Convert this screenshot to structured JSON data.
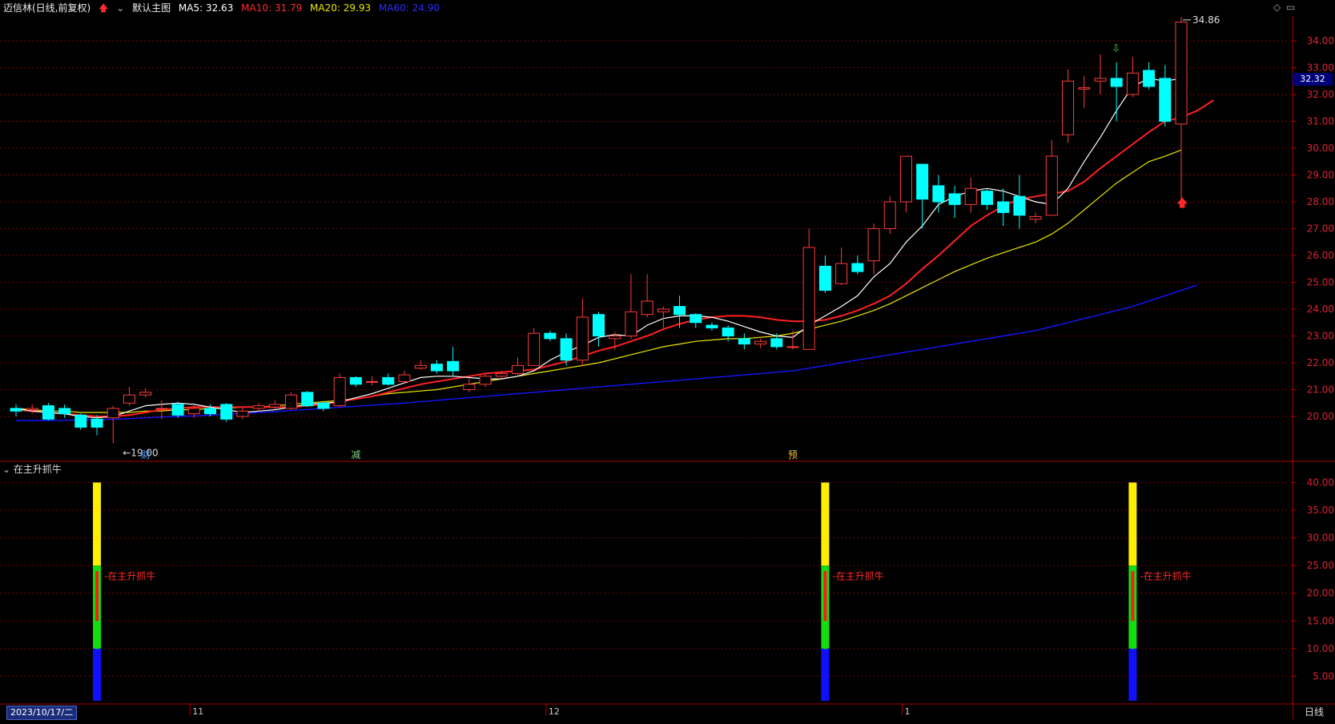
{
  "header": {
    "stock_name": "迈信林(日线,前复权)",
    "main_chart_label": "默认主图",
    "ma5": "MA5: 32.63",
    "ma10": "MA10: 31.79",
    "ma20": "MA20: 29.93",
    "ma60": "MA60: 24.90"
  },
  "colors": {
    "up": "#ff3b3b",
    "down": "#00ffff",
    "ma5": "#ffffff",
    "ma10": "#ff2020",
    "ma20": "#e8e800",
    "ma60": "#1515ff",
    "grid": "#7a0000"
  },
  "price_axis_labels": [
    "34.00",
    "33.00",
    "32.00",
    "31.00",
    "30.00",
    "29.00",
    "28.00",
    "27.00",
    "26.00",
    "25.00",
    "24.00",
    "23.00",
    "22.00",
    "21.00",
    "20.00"
  ],
  "current_price_tag": "32.32",
  "annotations": {
    "high_label": "34.86",
    "low_label": "19.00",
    "events": [
      "财",
      "减",
      "预"
    ]
  },
  "indicator": {
    "title": "在主升抓牛",
    "axis_labels": [
      "40.00",
      "35.00",
      "30.00",
      "25.00",
      "20.00",
      "15.00",
      "10.00",
      "5.00"
    ],
    "signal_label": "在主升抓牛"
  },
  "time_axis": {
    "cursor_date": "2023/10/17/二",
    "month_labels": [
      "11",
      "12",
      "1"
    ],
    "period": "日线"
  },
  "chart_data": {
    "type": "candlestick",
    "ylim": [
      19.0,
      35.0
    ],
    "candles": [
      [
        20.3,
        20.2,
        20.45,
        20.0
      ],
      [
        20.25,
        20.3,
        20.45,
        20.1
      ],
      [
        20.4,
        19.9,
        20.5,
        19.85
      ],
      [
        20.3,
        20.1,
        20.45,
        19.95
      ],
      [
        20.05,
        19.6,
        20.1,
        19.5
      ],
      [
        19.9,
        19.6,
        20.05,
        19.3
      ],
      [
        19.95,
        20.3,
        20.4,
        19.0
      ],
      [
        20.5,
        20.8,
        21.1,
        20.4
      ],
      [
        20.8,
        20.9,
        21.05,
        20.7
      ],
      [
        20.3,
        20.3,
        20.6,
        19.9
      ],
      [
        20.45,
        20.05,
        20.55,
        19.95
      ],
      [
        20.1,
        20.3,
        20.4,
        19.95
      ],
      [
        20.3,
        20.1,
        20.45,
        20.0
      ],
      [
        20.45,
        19.9,
        20.5,
        19.8
      ],
      [
        20.0,
        20.2,
        20.35,
        19.9
      ],
      [
        20.3,
        20.4,
        20.5,
        20.2
      ],
      [
        20.35,
        20.45,
        20.6,
        20.25
      ],
      [
        20.3,
        20.8,
        20.9,
        20.25
      ],
      [
        20.9,
        20.4,
        20.95,
        20.35
      ],
      [
        20.5,
        20.3,
        20.55,
        20.2
      ],
      [
        20.4,
        21.45,
        21.6,
        20.35
      ],
      [
        21.45,
        21.2,
        21.5,
        21.1
      ],
      [
        21.3,
        21.3,
        21.5,
        21.15
      ],
      [
        21.45,
        21.2,
        21.6,
        21.15
      ],
      [
        21.3,
        21.55,
        21.7,
        21.2
      ],
      [
        21.8,
        21.9,
        22.1,
        21.75
      ],
      [
        21.95,
        21.7,
        22.1,
        21.6
      ],
      [
        22.05,
        21.7,
        22.6,
        21.5
      ],
      [
        21.0,
        21.2,
        21.4,
        20.9
      ],
      [
        21.2,
        21.5,
        21.6,
        21.1
      ],
      [
        21.5,
        21.6,
        21.7,
        21.4
      ],
      [
        21.6,
        21.9,
        22.2,
        21.5
      ],
      [
        21.9,
        23.1,
        23.3,
        21.9
      ],
      [
        23.1,
        22.9,
        23.2,
        22.8
      ],
      [
        22.9,
        22.1,
        23.1,
        21.9
      ],
      [
        22.1,
        23.7,
        24.4,
        21.9
      ],
      [
        23.8,
        23.0,
        23.9,
        22.6
      ],
      [
        22.9,
        23.0,
        23.15,
        22.5
      ],
      [
        23.0,
        23.9,
        25.3,
        22.9
      ],
      [
        23.8,
        24.3,
        25.3,
        23.7
      ],
      [
        23.9,
        24.0,
        24.1,
        23.3
      ],
      [
        24.1,
        23.8,
        24.5,
        23.3
      ],
      [
        23.8,
        23.5,
        23.85,
        23.3
      ],
      [
        23.4,
        23.3,
        23.5,
        23.2
      ],
      [
        23.3,
        23.0,
        23.4,
        22.8
      ],
      [
        22.9,
        22.7,
        23.1,
        22.5
      ],
      [
        22.7,
        22.8,
        22.9,
        22.55
      ],
      [
        22.9,
        22.6,
        23.1,
        22.5
      ],
      [
        22.6,
        22.6,
        23.2,
        22.5
      ],
      [
        22.5,
        26.3,
        27.0,
        22.5
      ],
      [
        25.6,
        24.7,
        26.0,
        24.6
      ],
      [
        24.95,
        25.7,
        26.3,
        24.9
      ],
      [
        25.7,
        25.4,
        26.0,
        25.3
      ],
      [
        25.8,
        27.0,
        27.2,
        25.3
      ],
      [
        27.0,
        28.0,
        28.2,
        26.8
      ],
      [
        28.0,
        29.7,
        29.7,
        27.6
      ],
      [
        29.4,
        28.1,
        29.4,
        27.0
      ],
      [
        28.6,
        28.0,
        29.0,
        27.6
      ],
      [
        28.3,
        27.9,
        28.6,
        27.4
      ],
      [
        27.9,
        28.5,
        28.9,
        27.6
      ],
      [
        28.4,
        27.9,
        28.5,
        27.7
      ],
      [
        28.0,
        27.6,
        28.5,
        27.1
      ],
      [
        28.2,
        27.5,
        29.0,
        27.0
      ],
      [
        27.35,
        27.45,
        27.6,
        27.2
      ],
      [
        27.5,
        29.7,
        30.3,
        27.5
      ],
      [
        30.5,
        32.5,
        32.95,
        30.2
      ],
      [
        32.2,
        32.25,
        32.7,
        31.5
      ],
      [
        32.5,
        32.6,
        33.5,
        32.0
      ],
      [
        32.6,
        32.3,
        33.2,
        31.0
      ],
      [
        32.0,
        32.8,
        33.4,
        31.9
      ],
      [
        32.9,
        32.3,
        33.2,
        32.2
      ],
      [
        32.6,
        31.0,
        33.1,
        30.8
      ],
      [
        30.9,
        34.7,
        34.9,
        27.9
      ]
    ],
    "ma5": [
      20.3,
      20.2,
      20.15,
      20.1,
      20.0,
      19.95,
      20.0,
      20.2,
      20.4,
      20.45,
      20.5,
      20.45,
      20.35,
      20.25,
      20.15,
      20.2,
      20.25,
      20.35,
      20.45,
      20.5,
      20.55,
      20.7,
      20.85,
      21.05,
      21.25,
      21.45,
      21.5,
      21.5,
      21.45,
      21.4,
      21.4,
      21.5,
      21.7,
      22.1,
      22.4,
      22.65,
      22.95,
      23.05,
      23.0,
      23.4,
      23.65,
      23.75,
      23.75,
      23.7,
      23.55,
      23.35,
      23.15,
      23.0,
      22.95,
      23.4,
      23.75,
      24.1,
      24.5,
      25.2,
      25.7,
      26.5,
      27.1,
      27.9,
      28.2,
      28.4,
      28.5,
      28.4,
      28.2,
      28.0,
      27.9,
      28.5,
      29.5,
      30.4,
      31.4,
      32.3,
      32.6,
      32.5,
      32.6
    ],
    "ma10": [
      20.25,
      20.2,
      20.15,
      20.1,
      20.05,
      20.0,
      20.0,
      20.05,
      20.15,
      20.25,
      20.3,
      20.35,
      20.35,
      20.35,
      20.35,
      20.35,
      20.35,
      20.35,
      20.4,
      20.45,
      20.55,
      20.65,
      20.75,
      20.9,
      21.05,
      21.2,
      21.3,
      21.4,
      21.5,
      21.6,
      21.65,
      21.7,
      21.75,
      21.9,
      22.05,
      22.25,
      22.45,
      22.6,
      22.8,
      23.0,
      23.25,
      23.45,
      23.6,
      23.7,
      23.75,
      23.75,
      23.7,
      23.6,
      23.55,
      23.55,
      23.6,
      23.75,
      23.95,
      24.2,
      24.5,
      24.95,
      25.5,
      26.0,
      26.55,
      27.1,
      27.5,
      27.85,
      28.1,
      28.2,
      28.3,
      28.4,
      28.75,
      29.25,
      29.7,
      30.15,
      30.6,
      31.0,
      31.15,
      31.4,
      31.79
    ],
    "ma20": [
      20.3,
      20.25,
      20.2,
      20.2,
      20.15,
      20.15,
      20.15,
      20.15,
      20.2,
      20.2,
      20.25,
      20.25,
      20.3,
      20.3,
      20.35,
      20.35,
      20.4,
      20.45,
      20.5,
      20.55,
      20.6,
      20.65,
      20.75,
      20.85,
      20.9,
      20.95,
      21.0,
      21.1,
      21.2,
      21.3,
      21.4,
      21.5,
      21.6,
      21.7,
      21.8,
      21.9,
      22.0,
      22.15,
      22.3,
      22.45,
      22.6,
      22.7,
      22.8,
      22.85,
      22.9,
      22.9,
      22.95,
      23.0,
      23.1,
      23.25,
      23.4,
      23.55,
      23.75,
      23.95,
      24.2,
      24.5,
      24.8,
      25.1,
      25.4,
      25.65,
      25.9,
      26.1,
      26.3,
      26.5,
      26.8,
      27.2,
      27.7,
      28.2,
      28.7,
      29.1,
      29.5,
      29.7,
      29.93
    ],
    "ma60": [
      19.85,
      19.85,
      19.85,
      19.86,
      19.87,
      19.88,
      19.9,
      19.92,
      19.95,
      19.98,
      20.0,
      20.02,
      20.05,
      20.08,
      20.12,
      20.15,
      20.18,
      20.22,
      20.26,
      20.3,
      20.34,
      20.38,
      20.42,
      20.46,
      20.5,
      20.55,
      20.6,
      20.65,
      20.7,
      20.75,
      20.8,
      20.85,
      20.9,
      20.95,
      21.0,
      21.05,
      21.1,
      21.15,
      21.2,
      21.25,
      21.3,
      21.35,
      21.4,
      21.45,
      21.5,
      21.55,
      21.6,
      21.65,
      21.7,
      21.8,
      21.9,
      22.0,
      22.1,
      22.2,
      22.3,
      22.4,
      22.5,
      22.6,
      22.7,
      22.8,
      22.9,
      23.0,
      23.1,
      23.2,
      23.35,
      23.5,
      23.65,
      23.8,
      23.95,
      24.1,
      24.3,
      24.5,
      24.7,
      24.9
    ],
    "indicator_bars": [
      {
        "index": 5,
        "yellow": 40,
        "green": 25,
        "red_top": 24,
        "red_bottom": 15,
        "blue": 10
      },
      {
        "index": 50,
        "yellow": 40,
        "green": 25,
        "red_top": 24,
        "red_bottom": 15,
        "blue": 10
      },
      {
        "index": 69,
        "yellow": 40,
        "green": 25,
        "red_top": 24,
        "red_bottom": 15,
        "blue": 10
      }
    ]
  }
}
